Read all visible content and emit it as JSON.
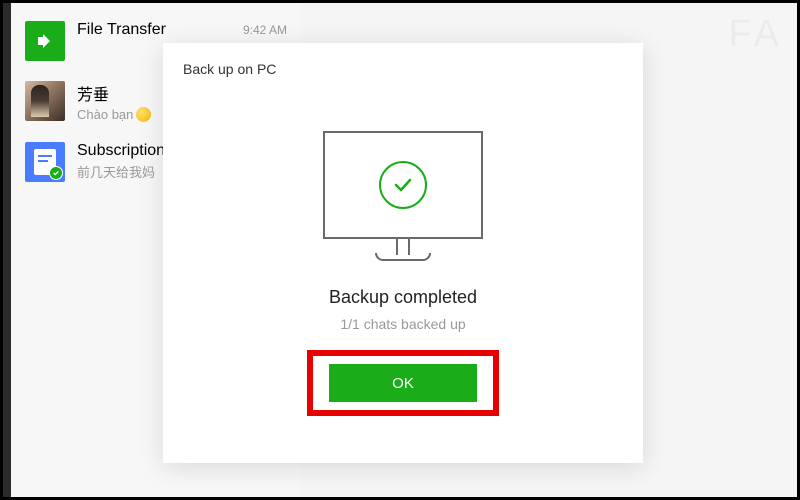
{
  "sidebar": {
    "chats": [
      {
        "name": "File Transfer",
        "time": "9:42 AM",
        "preview": ""
      },
      {
        "name": "芳垂",
        "time": "",
        "preview": "Chào bạn"
      },
      {
        "name": "Subscriptions",
        "time": "",
        "preview": "前几天给我妈"
      }
    ]
  },
  "dialog": {
    "title": "Back up on PC",
    "heading": "Backup completed",
    "subtext": "1/1 chats backed up",
    "ok_label": "OK"
  },
  "colors": {
    "brand_green": "#1aad19",
    "highlight_red": "#e60000"
  }
}
